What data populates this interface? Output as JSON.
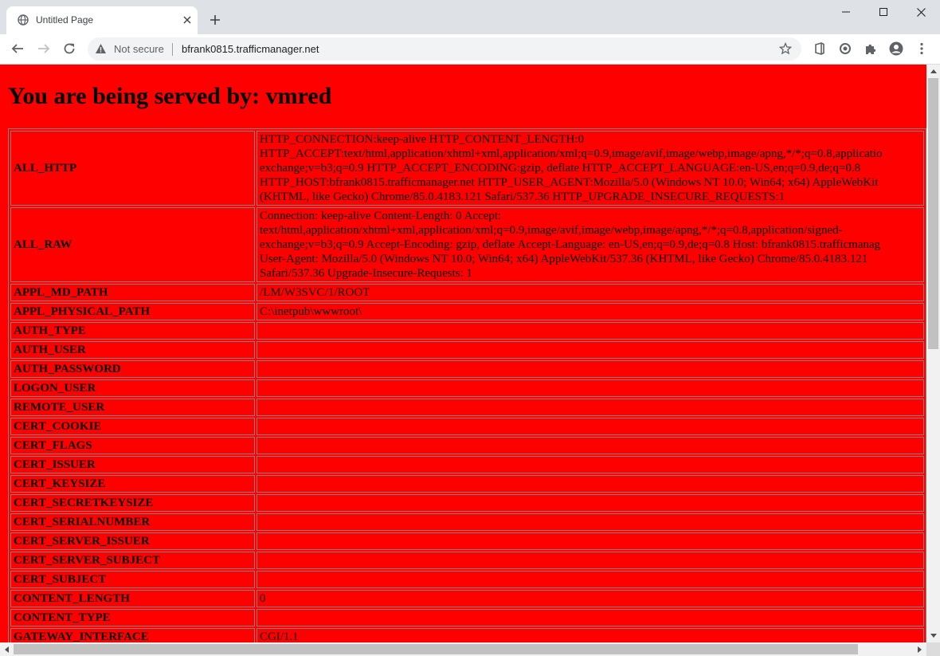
{
  "browser": {
    "tab_title": "Untitled Page",
    "security_label": "Not secure",
    "url": "bfrank0815.trafficmanager.net",
    "accent_color": "#dee1e6"
  },
  "page": {
    "heading": "You are being served by: vmred",
    "background_color": "#ff0000",
    "rows": [
      {
        "key": "ALL_HTTP",
        "lines": [
          "HTTP_CONNECTION:keep-alive HTTP_CONTENT_LENGTH:0",
          "HTTP_ACCEPT:text/html,application/xhtml+xml,application/xml;q=0.9,image/avif,image/webp,image/apng,*/*;q=0.8,applicatio",
          "exchange;v=b3;q=0.9 HTTP_ACCEPT_ENCODING:gzip, deflate HTTP_ACCEPT_LANGUAGE:en-US,en;q=0.9,de;q=0.8",
          "HTTP_HOST:bfrank0815.trafficmanager.net HTTP_USER_AGENT:Mozilla/5.0 (Windows NT 10.0; Win64; x64) AppleWebKit",
          "(KHTML, like Gecko) Chrome/85.0.4183.121 Safari/537.36 HTTP_UPGRADE_INSECURE_REQUESTS:1"
        ]
      },
      {
        "key": "ALL_RAW",
        "lines": [
          "Connection: keep-alive Content-Length: 0 Accept:",
          "text/html,application/xhtml+xml,application/xml;q=0.9,image/avif,image/webp,image/apng,*/*;q=0.8,application/signed-",
          "exchange;v=b3;q=0.9 Accept-Encoding: gzip, deflate Accept-Language: en-US,en;q=0.9,de;q=0.8 Host: bfrank0815.trafficmanag",
          "User-Agent: Mozilla/5.0 (Windows NT 10.0; Win64; x64) AppleWebKit/537.36 (KHTML, like Gecko) Chrome/85.0.4183.121",
          "Safari/537.36 Upgrade-Insecure-Requests: 1"
        ]
      },
      {
        "key": "APPL_MD_PATH",
        "lines": [
          "/LM/W3SVC/1/ROOT"
        ]
      },
      {
        "key": "APPL_PHYSICAL_PATH",
        "lines": [
          "C:\\inetpub\\wwwroot\\"
        ]
      },
      {
        "key": "AUTH_TYPE",
        "lines": [
          ""
        ]
      },
      {
        "key": "AUTH_USER",
        "lines": [
          ""
        ]
      },
      {
        "key": "AUTH_PASSWORD",
        "lines": [
          ""
        ]
      },
      {
        "key": "LOGON_USER",
        "lines": [
          ""
        ]
      },
      {
        "key": "REMOTE_USER",
        "lines": [
          ""
        ]
      },
      {
        "key": "CERT_COOKIE",
        "lines": [
          ""
        ]
      },
      {
        "key": "CERT_FLAGS",
        "lines": [
          ""
        ]
      },
      {
        "key": "CERT_ISSUER",
        "lines": [
          ""
        ]
      },
      {
        "key": "CERT_KEYSIZE",
        "lines": [
          ""
        ]
      },
      {
        "key": "CERT_SECRETKEYSIZE",
        "lines": [
          ""
        ]
      },
      {
        "key": "CERT_SERIALNUMBER",
        "lines": [
          ""
        ]
      },
      {
        "key": "CERT_SERVER_ISSUER",
        "lines": [
          ""
        ]
      },
      {
        "key": "CERT_SERVER_SUBJECT",
        "lines": [
          ""
        ]
      },
      {
        "key": "CERT_SUBJECT",
        "lines": [
          ""
        ]
      },
      {
        "key": "CONTENT_LENGTH",
        "lines": [
          "0"
        ]
      },
      {
        "key": "CONTENT_TYPE",
        "lines": [
          ""
        ]
      },
      {
        "key": "GATEWAY_INTERFACE",
        "lines": [
          "CGI/1.1"
        ]
      }
    ]
  }
}
